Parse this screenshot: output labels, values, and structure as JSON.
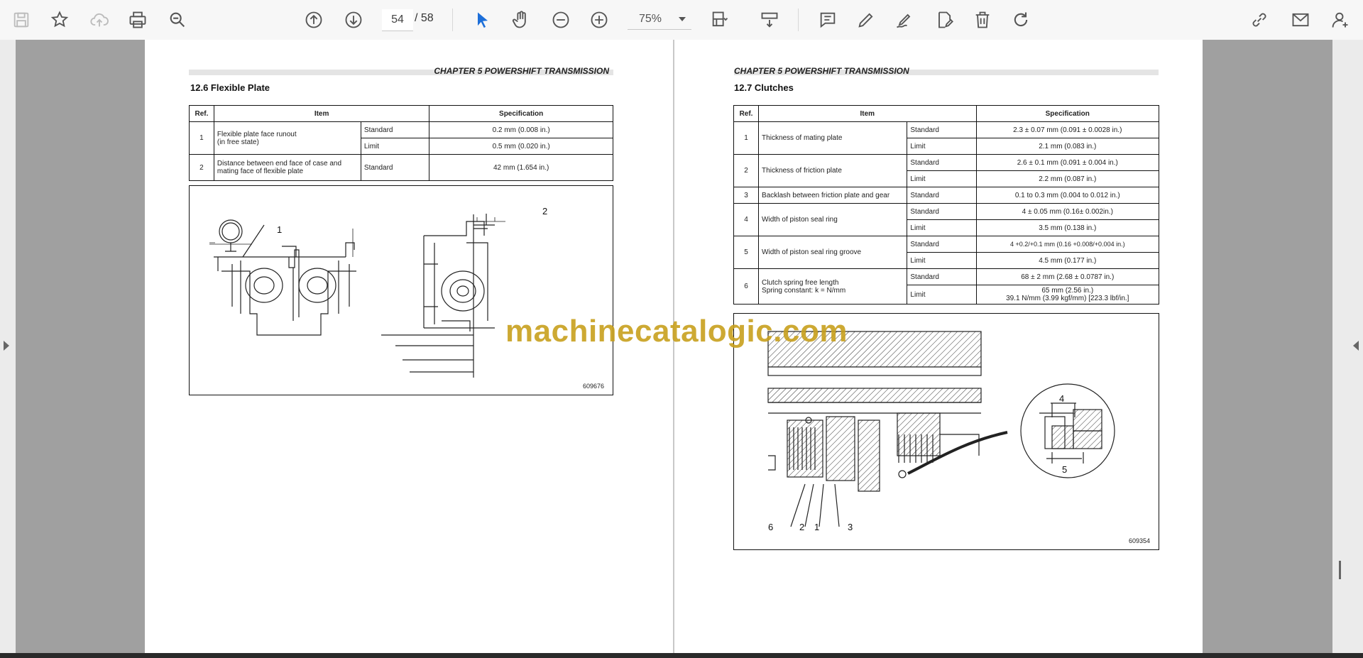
{
  "toolbar": {
    "page_current": "54",
    "page_total": "/ 58",
    "zoom": "75%"
  },
  "left_page": {
    "chapter": "CHAPTER 5 POWERSHIFT TRANSMISSION",
    "section": "12.6   Flexible Plate",
    "headers": [
      "Ref.",
      "Item",
      "Specification"
    ],
    "rows": [
      {
        "ref": "1",
        "item": "Flexible plate face runout\n(in free state)",
        "sub": [
          [
            "Standard",
            "0.2 mm (0.008 in.)"
          ],
          [
            "Limit",
            "0.5 mm (0.020 in.)"
          ]
        ]
      },
      {
        "ref": "2",
        "item": "Distance between end face of case and mating face of flexible plate",
        "sub": [
          [
            "Standard",
            "42 mm (1.654 in.)"
          ]
        ]
      }
    ],
    "figure": {
      "callout_1": "1",
      "callout_2": "2",
      "number": "609676"
    }
  },
  "right_page": {
    "chapter": "CHAPTER 5 POWERSHIFT TRANSMISSION",
    "section": "12.7   Clutches",
    "headers": [
      "Ref.",
      "Item",
      "Specification"
    ],
    "rows": [
      {
        "ref": "1",
        "item": "Thickness of mating plate",
        "sub": [
          [
            "Standard",
            "2.3 ± 0.07 mm (0.091 ± 0.0028 in.)"
          ],
          [
            "Limit",
            "2.1 mm (0.083 in.)"
          ]
        ]
      },
      {
        "ref": "2",
        "item": "Thickness of friction plate",
        "sub": [
          [
            "Standard",
            "2.6 ± 0.1 mm (0.091 ± 0.004 in.)"
          ],
          [
            "Limit",
            "2.2 mm (0.087 in.)"
          ]
        ]
      },
      {
        "ref": "3",
        "item": "Backlash between friction plate and gear",
        "sub": [
          [
            "Standard",
            "0.1 to 0.3 mm (0.004 to 0.012 in.)"
          ]
        ]
      },
      {
        "ref": "4",
        "item": "Width of piston seal ring",
        "sub": [
          [
            "Standard",
            "4 ± 0.05 mm (0.16± 0.002in.)"
          ],
          [
            "Limit",
            "3.5 mm (0.138 in.)"
          ]
        ]
      },
      {
        "ref": "5",
        "item": "Width of piston seal ring groove",
        "sub": [
          [
            "Standard",
            "4 +0.2/+0.1 mm (0.16 +0.008/+0.004 in.)"
          ],
          [
            "Limit",
            "4.5 mm (0.177 in.)"
          ]
        ]
      },
      {
        "ref": "6",
        "item": "Clutch spring free length\nSpring constant: k = N/mm",
        "sub": [
          [
            "Standard",
            "68 ± 2 mm (2.68 ± 0.0787 in.)"
          ],
          [
            "Limit",
            "65 mm (2.56 in.)\n39.1 N/mm (3.99 kgf/mm) [223.3 lbf/in.]"
          ]
        ]
      }
    ],
    "figure": {
      "callouts": [
        "6",
        "2",
        "1",
        "3",
        "4",
        "5"
      ],
      "number": "609354"
    }
  },
  "watermark": "machinecatalogic.com"
}
